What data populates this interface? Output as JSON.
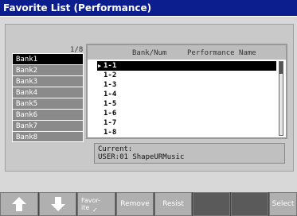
{
  "title": "Favorite List (Performance)",
  "banks": {
    "page_indicator": "1/8",
    "items": [
      "Bank1",
      "Bank2",
      "Bank3",
      "Bank4",
      "Bank5",
      "Bank6",
      "Bank7",
      "Bank8"
    ],
    "selected_index": 0
  },
  "list": {
    "header_bank": "Bank/Num",
    "header_performance": "Performance Name",
    "items": [
      "1-1",
      "1-2",
      "1-3",
      "1-4",
      "1-5",
      "1-6",
      "1-7",
      "1-8"
    ],
    "selected_index": 0
  },
  "current": {
    "label": "Current:",
    "value": "USER:01 ShapeURMusic"
  },
  "buttons": {
    "up_icon": "arrow-up-icon",
    "down_icon": "arrow-down-icon",
    "favorite_line1": "Favor-",
    "favorite_line2": "ite",
    "favorite_mark": "✓",
    "remove": "Remove",
    "resist": "Resist",
    "select": "Select"
  }
}
